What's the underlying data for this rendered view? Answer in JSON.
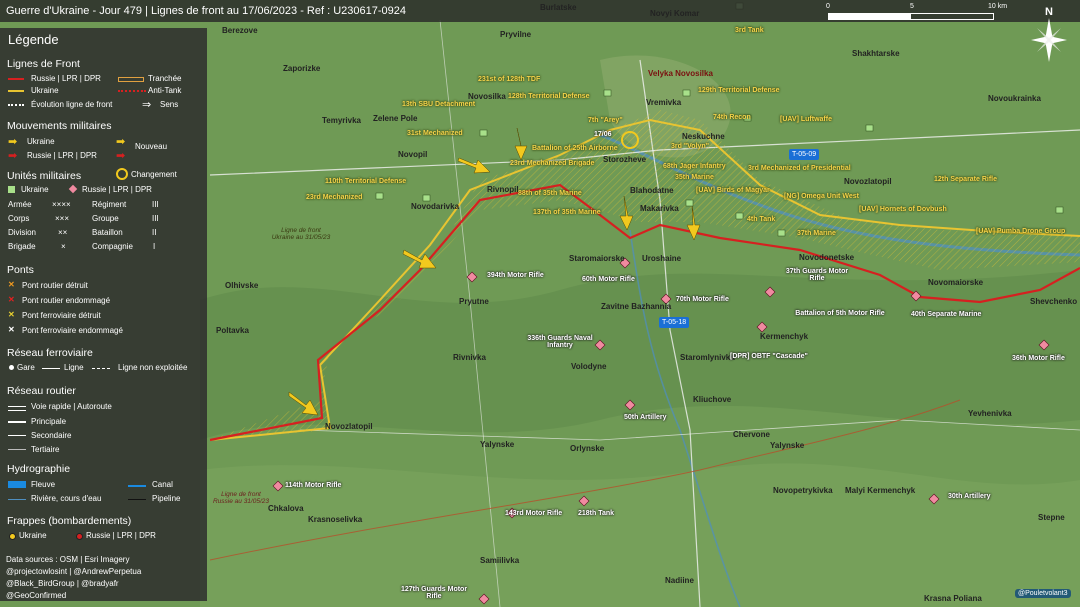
{
  "header": {
    "title": "Guerre d'Ukraine - Jour 479 | Lignes de front au 17/06/2023 - Ref : U230617-0924",
    "scale_labels": [
      "0",
      "5",
      "10 km"
    ],
    "north_label": "N"
  },
  "legend": {
    "title": "Légende",
    "front_lines": {
      "heading": "Lignes de Front",
      "russia": "Russie | LPR | DPR",
      "ukraine": "Ukraine",
      "trench": "Tranchée",
      "antitank": "Anti-Tank",
      "evolution": "Évolution ligne de front",
      "direction": "Sens"
    },
    "movements": {
      "heading": "Mouvements militaires",
      "ukraine": "Ukraine",
      "russia": "Russie | LPR | DPR",
      "new": "Nouveau",
      "change": "Changement"
    },
    "units": {
      "heading": "Unités militaires",
      "ukraine": "Ukraine",
      "russia": "Russie | LPR | DPR",
      "rows": [
        {
          "a": "Armée",
          "as": "××××",
          "b": "Régiment",
          "bs": "III"
        },
        {
          "a": "Corps",
          "as": "×××",
          "b": "Groupe",
          "bs": "III"
        },
        {
          "a": "Division",
          "as": "××",
          "b": "Bataillon",
          "bs": "II"
        },
        {
          "a": "Brigade",
          "as": "×",
          "b": "Compagnie",
          "bs": "I"
        }
      ]
    },
    "bridges": {
      "heading": "Ponts",
      "items": [
        "Pont routier détruit",
        "Pont routier endommagé",
        "Pont ferroviaire détruit",
        "Pont ferroviaire endommagé"
      ]
    },
    "rail": {
      "heading": "Réseau ferroviaire",
      "station": "Gare",
      "line": "Ligne",
      "unused": "Ligne non exploitée"
    },
    "roads": {
      "heading": "Réseau routier",
      "items": [
        "Voie rapide | Autoroute",
        "Principale",
        "Secondaire",
        "Tertiaire"
      ]
    },
    "hydro": {
      "heading": "Hydrographie",
      "river_big": "Fleuve",
      "canal": "Canal",
      "river_small": "Rivière, cours d'eau",
      "pipeline": "Pipeline"
    },
    "strikes": {
      "heading": "Frappes (bombardements)",
      "ukraine": "Ukraine",
      "russia": "Russie | LPR | DPR"
    },
    "sources": [
      "Data sources : OSM | Esri Imagery",
      "@projectowlosint | @AndrewPerpetua",
      "@Black_BirdGroup | @bradyafr",
      "@GeoConfirmed"
    ]
  },
  "map": {
    "colors": {
      "russia": "#d62020",
      "ukraine": "#e8c431",
      "trench": "#e0a040",
      "terrain": "#6f9a55",
      "road_badge": "#1a6fd6"
    },
    "change_date": "17/06",
    "road_badges": [
      "T-05-09",
      "T-05-18"
    ],
    "front_notes": [
      "Ligne de front Ukraine au 31/05/23",
      "Ligne de front Russie au 31/05/23"
    ],
    "places": [
      "Burlatske",
      "Novyi Komar",
      "Berezove",
      "Pryvilne",
      "Zaporizke",
      "Vremivka",
      "Velyka Novosilka",
      "Shakhtarske",
      "Novosilka",
      "Zelene Pole",
      "Novoukrainka",
      "Temyrivka",
      "Novopil",
      "Neskuchne",
      "Storozheve",
      "Blahodatne",
      "Makarivka",
      "Novozlatopil",
      "Rivnopil",
      "Novodarivka",
      "Uroshaine",
      "Staromaiorske",
      "Novodonetske",
      "Novomaiorske",
      "Shevchenko",
      "Pryutne",
      "Zavitne Bazhannia",
      "Kermenchyk",
      "Olhivske",
      "Poltavka",
      "Rivnivka",
      "Volodyne",
      "Staromlynivka",
      "Kliuchove",
      "Yevhenivka",
      "Levadne",
      "Novozlatopil",
      "Ocheretuvate",
      "Chervone",
      "Yalynske",
      "Pavlivka",
      "Orlynske",
      "Novopetrykivka",
      "Malyi Kermenchyk",
      "Chkalova",
      "Krasnoselivka",
      "Samiilivka",
      "Nadiine",
      "Stepne",
      "Krasna Poliana",
      "Zelenyi Hai",
      "Novopokrovka"
    ],
    "ukraine_units": [
      "3rd Tank",
      "231st of 128th TDF",
      "13th SBU Detachment",
      "128th Territorial Defense",
      "129th Territorial Defense",
      "31st Mechanized",
      "7th \"Arey\"",
      "74th Recon",
      "[UAV] Luftwaffe",
      "3rd \"Volyn\"",
      "Battalion of 25th Airborne",
      "23rd Mechanized Brigade",
      "68th Jager Infantry",
      "35th Marine",
      "3rd Mechanized of Presidential",
      "110th Territorial Defense",
      "23rd Mechanized",
      "88th of 35th Marine",
      "[UAV] Birds of Magyar",
      "[NG] Omega Unit West",
      "12th Separate Rifle",
      "137th of 35th Marine",
      "4th Tank",
      "[UAV] Hornets of Dovbush",
      "37th Marine",
      "[UAV] Pumba Drone Group"
    ],
    "russia_units": [
      "394th Motor Rifle",
      "60th Motor Rifle",
      "70th Motor Rifle",
      "37th Guards Motor Rifle",
      "Battalion of 5th Motor Rifle",
      "40th Separate Marine",
      "336th Guards Naval Infantry",
      "[DPR] OBTF \"Cascade\"",
      "36th Motor Rifle",
      "50th Artillery",
      "114th Motor Rifle",
      "143rd Motor Rifle",
      "218th Tank",
      "30th Artillery",
      "127th Guards Motor Rifle"
    ],
    "credit": "@Pouletvolant3"
  }
}
